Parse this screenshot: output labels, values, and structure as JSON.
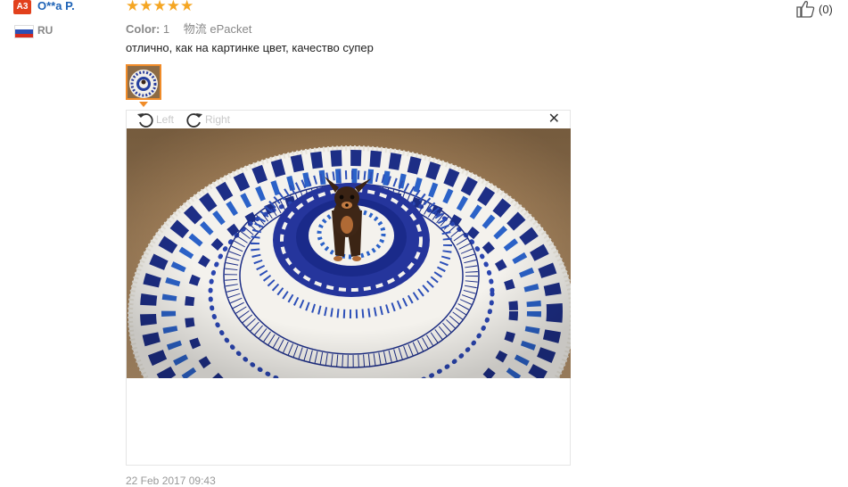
{
  "reviewer": {
    "badge": "A3",
    "name": "O**a P.",
    "country": "RU"
  },
  "review": {
    "rating": 5,
    "stars": "★★★★★",
    "color_label": "Color:",
    "color_value": "1",
    "shipping_label": "物流",
    "shipping_value": "ePacket",
    "text": "отлично, как на картинке цвет, качество супер",
    "date": "22 Feb 2017 09:43"
  },
  "helpful": {
    "count": "(0)",
    "icon": "thumbs-up-icon"
  },
  "viewer": {
    "rotate_left_label": "Left",
    "rotate_right_label": "Right",
    "close_icon": "close-icon"
  },
  "colors": {
    "accent_orange": "#f08c2a",
    "badge_red": "#e2401c",
    "link_blue": "#1d62b6",
    "star": "#f5a623"
  }
}
